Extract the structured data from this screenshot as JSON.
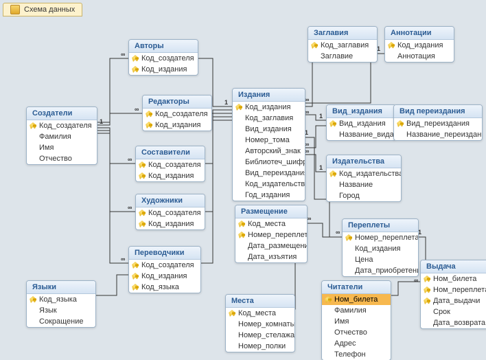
{
  "window": {
    "tab_title": "Схема данных"
  },
  "tables": {
    "sozdateli": {
      "title": "Создатели",
      "fields": [
        {
          "label": "Код_создателя",
          "pk": true
        },
        {
          "label": "Фамилия",
          "pk": false
        },
        {
          "label": "Имя",
          "pk": false
        },
        {
          "label": "Отчество",
          "pk": false
        }
      ]
    },
    "avtory": {
      "title": "Авторы",
      "fields": [
        {
          "label": "Код_создателя",
          "pk": true
        },
        {
          "label": "Код_издания",
          "pk": true
        }
      ]
    },
    "redaktory": {
      "title": "Редакторы",
      "fields": [
        {
          "label": "Код_создателя",
          "pk": true
        },
        {
          "label": "Код_издания",
          "pk": true
        }
      ]
    },
    "sostaviteli": {
      "title": "Составители",
      "fields": [
        {
          "label": "Код_создателя",
          "pk": true
        },
        {
          "label": "Код_издания",
          "pk": true
        }
      ]
    },
    "hudozhniki": {
      "title": "Художники",
      "fields": [
        {
          "label": "Код_создателя",
          "pk": true
        },
        {
          "label": "Код_издания",
          "pk": true
        }
      ]
    },
    "perevodchiki": {
      "title": "Переводчики",
      "fields": [
        {
          "label": "Код_создателя",
          "pk": true
        },
        {
          "label": "Код_издания",
          "pk": true
        },
        {
          "label": "Код_языка",
          "pk": true
        }
      ]
    },
    "yazyki": {
      "title": "Языки",
      "fields": [
        {
          "label": "Код_языка",
          "pk": true
        },
        {
          "label": "Язык",
          "pk": false
        },
        {
          "label": "Сокращение",
          "pk": false
        }
      ]
    },
    "izdaniya": {
      "title": "Издания",
      "fields": [
        {
          "label": "Код_издания",
          "pk": true
        },
        {
          "label": "Код_заглавия",
          "pk": false
        },
        {
          "label": "Вид_издания",
          "pk": false
        },
        {
          "label": "Номер_тома",
          "pk": false
        },
        {
          "label": "Авторский_знак",
          "pk": false
        },
        {
          "label": "Библиотеч_шифр",
          "pk": false
        },
        {
          "label": "Вид_переиздания",
          "pk": false
        },
        {
          "label": "Код_издательства",
          "pk": false
        },
        {
          "label": "Год_издания",
          "pk": false
        }
      ]
    },
    "zaglaviya": {
      "title": "Заглавия",
      "fields": [
        {
          "label": "Код_заглавия",
          "pk": true
        },
        {
          "label": "Заглавие",
          "pk": false
        }
      ]
    },
    "annotacii": {
      "title": "Аннотации",
      "fields": [
        {
          "label": "Код_издания",
          "pk": true
        },
        {
          "label": "Аннотация",
          "pk": false
        }
      ]
    },
    "vid_izdaniya": {
      "title": "Вид_издания",
      "fields": [
        {
          "label": "Вид_издания",
          "pk": true
        },
        {
          "label": "Название_вида",
          "pk": false
        }
      ]
    },
    "vid_pereizdaniya": {
      "title": "Вид переиздания",
      "fields": [
        {
          "label": "Вид_переиздания",
          "pk": true
        },
        {
          "label": "Название_переиздания",
          "pk": false
        }
      ]
    },
    "izdatelstva": {
      "title": "Издательства",
      "fields": [
        {
          "label": "Код_издательства",
          "pk": true
        },
        {
          "label": "Название",
          "pk": false
        },
        {
          "label": "Город",
          "pk": false
        }
      ]
    },
    "razmeshenie": {
      "title": "Размещение",
      "fields": [
        {
          "label": "Код_места",
          "pk": true
        },
        {
          "label": "Номер_переплета",
          "pk": true
        },
        {
          "label": "Дата_размещения",
          "pk": false
        },
        {
          "label": "Дата_изъятия",
          "pk": false
        }
      ]
    },
    "mesta": {
      "title": "Места",
      "fields": [
        {
          "label": "Код_места",
          "pk": true
        },
        {
          "label": "Номер_комнаты",
          "pk": false
        },
        {
          "label": "Номер_стелажа",
          "pk": false
        },
        {
          "label": "Номер_полки",
          "pk": false
        }
      ]
    },
    "pereplety": {
      "title": "Переплеты",
      "fields": [
        {
          "label": "Номер_переплета",
          "pk": true
        },
        {
          "label": "Код_издания",
          "pk": false
        },
        {
          "label": "Цена",
          "pk": false
        },
        {
          "label": "Дата_приобретения",
          "pk": false
        }
      ]
    },
    "chitateli": {
      "title": "Читатели",
      "fields": [
        {
          "label": "Ном_билета",
          "pk": true,
          "selected": true
        },
        {
          "label": "Фамилия",
          "pk": false
        },
        {
          "label": "Имя",
          "pk": false
        },
        {
          "label": "Отчество",
          "pk": false
        },
        {
          "label": "Адрес",
          "pk": false
        },
        {
          "label": "Телефон",
          "pk": false
        }
      ]
    },
    "vydacha": {
      "title": "Выдача",
      "fields": [
        {
          "label": "Ном_билета",
          "pk": true
        },
        {
          "label": "Ном_переплета",
          "pk": true
        },
        {
          "label": "Дата_выдачи",
          "pk": true
        },
        {
          "label": "Срок",
          "pk": false
        },
        {
          "label": "Дата_возврата",
          "pk": false
        }
      ]
    }
  },
  "relationships": [
    {
      "from": "sozdateli",
      "to": "avtory",
      "card_from": "1",
      "card_to": "∞"
    },
    {
      "from": "sozdateli",
      "to": "redaktory",
      "card_from": "1",
      "card_to": "∞"
    },
    {
      "from": "sozdateli",
      "to": "sostaviteli",
      "card_from": "1",
      "card_to": "∞"
    },
    {
      "from": "sozdateli",
      "to": "hudozhniki",
      "card_from": "1",
      "card_to": "∞"
    },
    {
      "from": "sozdateli",
      "to": "perevodchiki",
      "card_from": "1",
      "card_to": "∞"
    },
    {
      "from": "yazyki",
      "to": "perevodchiki",
      "card_from": "1",
      "card_to": "∞"
    },
    {
      "from": "avtory",
      "to": "izdaniya",
      "card_from": "∞",
      "card_to": "1"
    },
    {
      "from": "redaktory",
      "to": "izdaniya",
      "card_from": "∞",
      "card_to": "1"
    },
    {
      "from": "sostaviteli",
      "to": "izdaniya",
      "card_from": "∞",
      "card_to": "1"
    },
    {
      "from": "hudozhniki",
      "to": "izdaniya",
      "card_from": "∞",
      "card_to": "1"
    },
    {
      "from": "perevodchiki",
      "to": "izdaniya",
      "card_from": "∞",
      "card_to": "1"
    },
    {
      "from": "zaglaviya",
      "to": "izdaniya",
      "card_from": "1",
      "card_to": "∞"
    },
    {
      "from": "izdaniya",
      "to": "annotacii",
      "card_from": "1",
      "card_to": "1"
    },
    {
      "from": "izdaniya",
      "to": "vid_izdaniya",
      "card_from": "∞",
      "card_to": "1"
    },
    {
      "from": "izdaniya",
      "to": "vid_pereizdaniya",
      "card_from": "∞",
      "card_to": "1"
    },
    {
      "from": "izdaniya",
      "to": "izdatelstva",
      "card_from": "∞",
      "card_to": "1"
    },
    {
      "from": "izdaniya",
      "to": "pereplety",
      "card_from": "1",
      "card_to": "∞"
    },
    {
      "from": "pereplety",
      "to": "razmeshenie",
      "card_from": "1",
      "card_to": "∞"
    },
    {
      "from": "mesta",
      "to": "razmeshenie",
      "card_from": "1",
      "card_to": "∞"
    },
    {
      "from": "pereplety",
      "to": "vydacha",
      "card_from": "1",
      "card_to": "∞"
    },
    {
      "from": "chitateli",
      "to": "vydacha",
      "card_from": "1",
      "card_to": "∞"
    }
  ],
  "rel_labels": {
    "one": "1",
    "many": "∞"
  }
}
